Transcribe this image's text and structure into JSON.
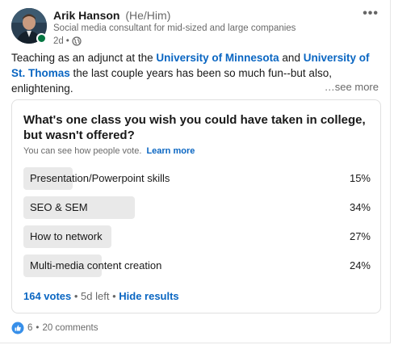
{
  "post": {
    "author": {
      "name": "Arik Hanson",
      "pronouns": "(He/Him)",
      "headline": "Social media consultant for mid-sized and large companies",
      "time": "2d",
      "separator": "•"
    },
    "body": {
      "part1": "Teaching as an adjunct at the ",
      "link1": "University of Minnesota",
      "part2": " and ",
      "link2": "University of St. Thomas",
      "part3": " the last couple years has been so much fun--but also, enlightening.",
      "see_more": "…see more"
    }
  },
  "poll": {
    "question": "What's one class you wish you could have taken in college, but wasn't offered?",
    "visibility_note": "You can see how people vote.",
    "learn_more": "Learn more",
    "options": [
      {
        "label": "Presentation/Powerpoint skills",
        "percent": "15%",
        "fraction": 0.15
      },
      {
        "label": "SEO & SEM",
        "percent": "34%",
        "fraction": 0.34
      },
      {
        "label": "How to network",
        "percent": "27%",
        "fraction": 0.27
      },
      {
        "label": "Multi-media content creation",
        "percent": "24%",
        "fraction": 0.24
      }
    ],
    "votes": "164 votes",
    "sep1": " • ",
    "time_left": "5d left",
    "sep2": " • ",
    "hide_results": "Hide results"
  },
  "social": {
    "reactions": "6",
    "separator": "•",
    "comments": "20 comments"
  },
  "colors": {
    "link": "#0a66c2",
    "presence": "#057642",
    "bar": "#e9e9e9"
  },
  "icons": {
    "more": "more-horizontal-icon",
    "visibility": "globe-icon",
    "reaction": "like-icon"
  }
}
